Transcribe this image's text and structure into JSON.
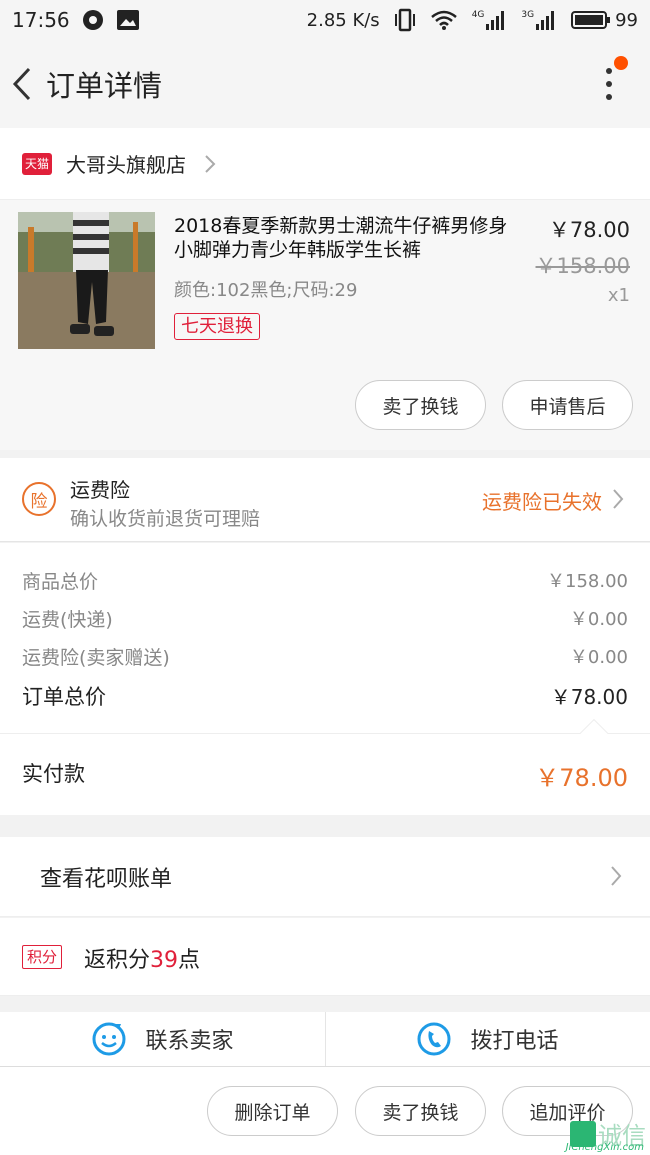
{
  "statusbar": {
    "time": "17:56",
    "speed": "2.85 K/s",
    "net1": "4G",
    "net2": "3G",
    "battery": "99"
  },
  "navbar": {
    "title": "订单详情"
  },
  "shop": {
    "logo_text": "天猫",
    "name": "大哥头旗舰店"
  },
  "product": {
    "title": "2018春夏季新款男士潮流牛仔裤男修身小脚弹力青少年韩版学生长裤",
    "spec": "颜色:102黑色;尺码:29",
    "tag": "七天退换",
    "price": "￥78.00",
    "original_price": "￥158.00",
    "quantity": "x1",
    "btn_sell": "卖了换钱",
    "btn_aftersale": "申请售后"
  },
  "insurance": {
    "icon_text": "险",
    "title": "运费险",
    "desc": "确认收货前退货可理赔",
    "status": "运费险已失效"
  },
  "summary": {
    "rows": [
      {
        "label": "商品总价",
        "value": "￥158.00"
      },
      {
        "label": "运费(快递)",
        "value": "￥0.00"
      },
      {
        "label": "运费险(卖家赠送)",
        "value": "￥0.00"
      }
    ],
    "total_label": "订单总价",
    "total_value": "￥78.00"
  },
  "paid": {
    "label": "实付款",
    "value": "￥78.00"
  },
  "huabei": {
    "label": "查看花呗账单"
  },
  "points": {
    "badge": "积分",
    "prefix": "返积分",
    "number": "39",
    "suffix": "点"
  },
  "contact": {
    "seller": "联系卖家",
    "phone": "拨打电话"
  },
  "bottom": {
    "delete": "删除订单",
    "sell": "卖了换钱",
    "review": "追加评价"
  },
  "watermark": {
    "text": "诚信",
    "sub": "JiChengXin.com"
  },
  "colors": {
    "accent_orange": "#e8722c",
    "tmall_red": "#e0203a",
    "badge_orange": "#ff5000"
  }
}
